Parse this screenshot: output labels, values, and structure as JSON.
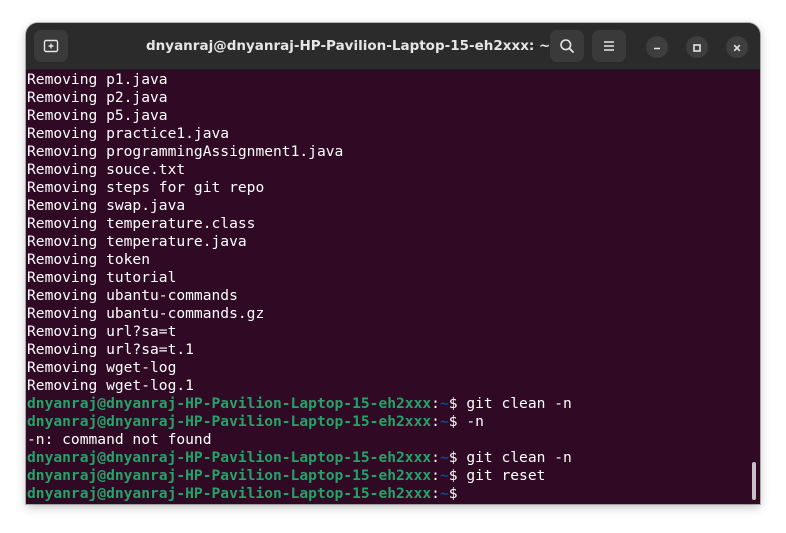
{
  "window": {
    "title": "dnyanraj@dnyanraj-HP-Pavilion-Laptop-15-eh2xxx: ~"
  },
  "titlebar": {
    "new_tab_icon": "new-tab-icon",
    "search_icon": "search-icon",
    "menu_icon": "hamburger-menu-icon",
    "minimize_icon": "minimize-icon",
    "maximize_icon": "maximize-icon",
    "close_icon": "close-icon"
  },
  "colors": {
    "terminal_bg": "#300a24",
    "titlebar_bg": "#2b2b2b",
    "prompt_user": "#26a269",
    "prompt_path": "#12488b",
    "text": "#ffffff"
  },
  "terminal": {
    "output_lines": [
      "Removing p1.java",
      "Removing p2.java",
      "Removing p5.java",
      "Removing practice1.java",
      "Removing programmingAssignment1.java",
      "Removing souce.txt",
      "Removing steps for git repo",
      "Removing swap.java",
      "Removing temperature.class",
      "Removing temperature.java",
      "Removing token",
      "Removing tutorial",
      "Removing ubantu-commands",
      "Removing ubantu-commands.gz",
      "Removing url?sa=t",
      "Removing url?sa=t.1",
      "Removing wget-log",
      "Removing wget-log.1"
    ],
    "prompt": {
      "user_host": "dnyanraj@dnyanraj-HP-Pavilion-Laptop-15-eh2xxx",
      "colon": ":",
      "path": "~",
      "symbol": "$ "
    },
    "session": [
      {
        "type": "prompt",
        "command": "git clean -n"
      },
      {
        "type": "prompt",
        "command": "-n"
      },
      {
        "type": "output",
        "text": "-n: command not found"
      },
      {
        "type": "prompt",
        "command": "git clean -n"
      },
      {
        "type": "prompt",
        "command": "git reset"
      },
      {
        "type": "prompt",
        "command": ""
      }
    ]
  }
}
